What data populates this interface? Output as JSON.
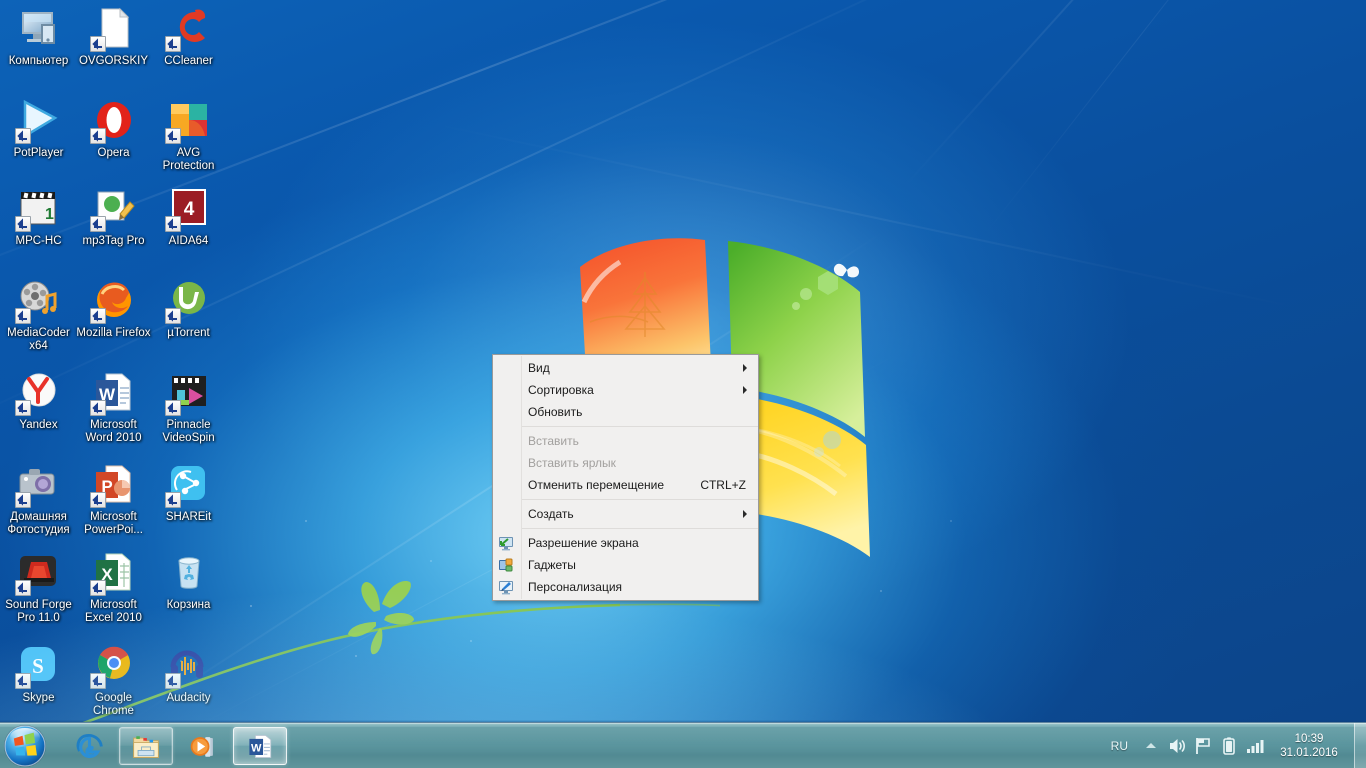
{
  "desktop": {
    "wallpaper_name": "windows-7-harmony-wallpaper",
    "background_color": "#0a4f9e",
    "icons": [
      {
        "label": "Компьютер",
        "icon": "computer-icon",
        "shortcut": false
      },
      {
        "label": "OVGORSKIY",
        "icon": "document-shortcut-icon",
        "shortcut": true
      },
      {
        "label": "CCleaner",
        "icon": "ccleaner-icon",
        "shortcut": true
      },
      {
        "label": "PotPlayer",
        "icon": "potplayer-icon",
        "shortcut": true
      },
      {
        "label": "Opera",
        "icon": "opera-icon",
        "shortcut": true
      },
      {
        "label": "AVG Protection",
        "icon": "avg-protection-icon",
        "shortcut": true
      },
      {
        "label": "MPC-HC",
        "icon": "mpc-hc-icon",
        "shortcut": true
      },
      {
        "label": "mp3Tag Pro",
        "icon": "mp3tag-pro-icon",
        "shortcut": true
      },
      {
        "label": "AIDA64",
        "icon": "aida64-icon",
        "shortcut": true
      },
      {
        "label": "MediaCoder x64",
        "icon": "mediacoder-icon",
        "shortcut": true
      },
      {
        "label": "Mozilla Firefox",
        "icon": "firefox-icon",
        "shortcut": true
      },
      {
        "label": "µTorrent",
        "icon": "utorrent-icon",
        "shortcut": true
      },
      {
        "label": "Yandex",
        "icon": "yandex-browser-icon",
        "shortcut": true
      },
      {
        "label": "Microsoft Word 2010",
        "icon": "ms-word-icon",
        "shortcut": true
      },
      {
        "label": "Pinnacle VideoSpin",
        "icon": "pinnacle-videospin-icon",
        "shortcut": true
      },
      {
        "label": "Домашняя Фотостудия",
        "icon": "home-photo-studio-icon",
        "shortcut": true
      },
      {
        "label": "Microsoft PowerPoi...",
        "icon": "ms-powerpoint-icon",
        "shortcut": true
      },
      {
        "label": "SHAREit",
        "icon": "shareit-icon",
        "shortcut": true
      },
      {
        "label": "Sound Forge Pro 11.0",
        "icon": "sound-forge-icon",
        "shortcut": true
      },
      {
        "label": "Microsoft Excel 2010",
        "icon": "ms-excel-icon",
        "shortcut": true
      },
      {
        "label": "Корзина",
        "icon": "recycle-bin-icon",
        "shortcut": false
      },
      {
        "label": "Skype",
        "icon": "skype-icon",
        "shortcut": true
      },
      {
        "label": "Google Chrome",
        "icon": "google-chrome-icon",
        "shortcut": true
      },
      {
        "label": "Audacity",
        "icon": "audacity-icon",
        "shortcut": true
      }
    ]
  },
  "context_menu": {
    "items": [
      {
        "label": "Вид",
        "icon": null,
        "shortcut": "",
        "submenu": true,
        "disabled": false
      },
      {
        "label": "Сортировка",
        "icon": null,
        "shortcut": "",
        "submenu": true,
        "disabled": false
      },
      {
        "label": "Обновить",
        "icon": null,
        "shortcut": "",
        "submenu": false,
        "disabled": false
      },
      {
        "separator": true
      },
      {
        "label": "Вставить",
        "icon": null,
        "shortcut": "",
        "submenu": false,
        "disabled": true
      },
      {
        "label": "Вставить ярлык",
        "icon": null,
        "shortcut": "",
        "submenu": false,
        "disabled": true
      },
      {
        "label": "Отменить перемещение",
        "icon": null,
        "shortcut": "CTRL+Z",
        "submenu": false,
        "disabled": false
      },
      {
        "separator": true
      },
      {
        "label": "Создать",
        "icon": null,
        "shortcut": "",
        "submenu": true,
        "disabled": false
      },
      {
        "separator": true
      },
      {
        "label": "Разрешение экрана",
        "icon": "screen-resolution-icon",
        "shortcut": "",
        "submenu": false,
        "disabled": false
      },
      {
        "label": "Гаджеты",
        "icon": "gadgets-icon",
        "shortcut": "",
        "submenu": false,
        "disabled": false
      },
      {
        "label": "Персонализация",
        "icon": "personalization-icon",
        "shortcut": "",
        "submenu": false,
        "disabled": false
      }
    ]
  },
  "taskbar": {
    "start_button": {
      "name": "Пуск",
      "icon": "windows-start-orb-icon"
    },
    "buttons": [
      {
        "label": "Internet Explorer",
        "icon": "internet-explorer-icon",
        "state": "pinned"
      },
      {
        "label": "Проводник",
        "icon": "windows-explorer-icon",
        "state": "running"
      },
      {
        "label": "Проигрыватель Windows Media",
        "icon": "windows-media-player-icon",
        "state": "pinned"
      },
      {
        "label": "Microsoft Word 2010",
        "icon": "ms-word-taskbar-icon",
        "state": "active"
      }
    ],
    "tray": {
      "language": "RU",
      "icons": [
        {
          "name": "show-hidden-icons-chevron-icon"
        },
        {
          "name": "volume-speaker-icon"
        },
        {
          "name": "action-center-flag-icon"
        },
        {
          "name": "battery-icon"
        },
        {
          "name": "network-signal-icon"
        }
      ],
      "clock": {
        "time": "10:39",
        "date": "31.01.2016"
      },
      "show_desktop_label": "Свернуть все окна"
    }
  }
}
